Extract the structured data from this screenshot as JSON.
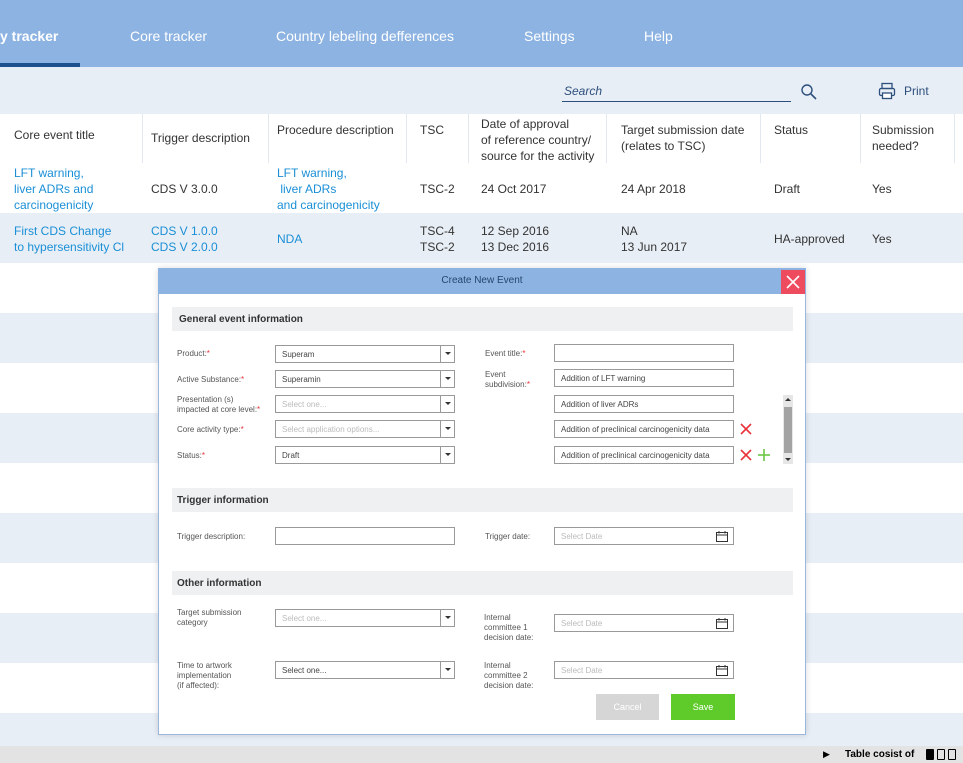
{
  "nav": {
    "tabs": [
      {
        "label": "y tracker"
      },
      {
        "label": "Core tracker"
      },
      {
        "label": "Country lebeling defferences"
      },
      {
        "label": "Settings"
      },
      {
        "label": "Help"
      }
    ]
  },
  "toolbar": {
    "search_label": "Search",
    "print_label": "Print"
  },
  "table": {
    "headers": [
      [
        "Core event title"
      ],
      [
        "Trigger description"
      ],
      [
        "Procedure description"
      ],
      [
        "TSC"
      ],
      [
        "Date of approval",
        "of reference country/",
        "source for the activity"
      ],
      [
        "Target submission date",
        "(relates to TSC)"
      ],
      [
        "Status"
      ],
      [
        "Submission",
        "needed?"
      ]
    ],
    "rows": [
      {
        "core_event_title": [
          "LFT warning,",
          "liver ADRs and",
          "carcinogenicity"
        ],
        "trigger": [
          "CDS V 3.0.0"
        ],
        "procedure": [
          "LFT warning,",
          " liver ADRs",
          "and carcinogenicity"
        ],
        "tsc": [
          "TSC-2"
        ],
        "date_approval": [
          "24 Oct 2017"
        ],
        "target_date": [
          "24 Apr 2018"
        ],
        "status": "Draft",
        "submission": "Yes"
      },
      {
        "core_event_title": [
          "First CDS Change",
          "to hypersensitivity Cl"
        ],
        "trigger": [
          "CDS V 1.0.0",
          "CDS V 2.0.0"
        ],
        "procedure": [
          "NDA"
        ],
        "tsc": [
          "TSC-4",
          "TSC-2"
        ],
        "date_approval": [
          "12 Sep 2016",
          "13 Dec 2016"
        ],
        "target_date": [
          "NA",
          "13 Jun 2017"
        ],
        "status": "HA-approved",
        "submission": "Yes"
      }
    ]
  },
  "modal": {
    "title": "Create New Event",
    "sections": {
      "general": "General event information",
      "trigger": "Trigger information",
      "other": "Other information"
    },
    "general": {
      "product_label": "Product:",
      "product_value": "Superam",
      "active_substance_label": "Active Substance:",
      "active_substance_value": "Superamin",
      "presentation_label_1": "Presentation (s)",
      "presentation_label_2": "impacted at core level:",
      "presentation_placeholder": "Select one...",
      "core_activity_label": "Core activity type:",
      "core_activity_placeholder": "Select application options...",
      "status_label": "Status:",
      "status_value": "Draft",
      "event_title_label": "Event title:",
      "event_title_value": "",
      "event_subdivision_label_1": "Event",
      "event_subdivision_label_2": "subdivision:",
      "subdivisions": [
        "Addition of LFT warning",
        "Addition of liver ADRs",
        "Addition of preclinical carcinogenicity data",
        "Addition of preclinical carcinogenicity data"
      ],
      "required_mark": "*"
    },
    "trigger": {
      "description_label": "Trigger description:",
      "description_value": "",
      "date_label": "Trigger date:",
      "date_placeholder": "Select Date"
    },
    "other": {
      "target_category_label_1": "Target submission",
      "target_category_label_2": "category",
      "target_category_placeholder": "Select one...",
      "time_artwork_label_1": "Time to artwork",
      "time_artwork_label_2": "implementation",
      "time_artwork_label_3": "(if affected):",
      "time_artwork_value": "Select one...",
      "committee1_label_1": "Internal",
      "committee1_label_2": "committee 1",
      "committee1_label_3": "decision date:",
      "committee1_placeholder": "Select Date",
      "committee2_label_1": "Internal",
      "committee2_label_2": "committee 2",
      "committee2_label_3": "decision date:",
      "committee2_placeholder": "Select Date"
    },
    "buttons": {
      "cancel": "Cancel",
      "save": "Save"
    }
  },
  "footer": {
    "label": "Table cosist of"
  },
  "colors": {
    "nav": "#8db3e2",
    "accent_dark": "#1e4f8f",
    "link": "#1a8fd6",
    "close": "#ef4b5f",
    "save": "#5ecb2a",
    "remove": "#e8333a"
  }
}
